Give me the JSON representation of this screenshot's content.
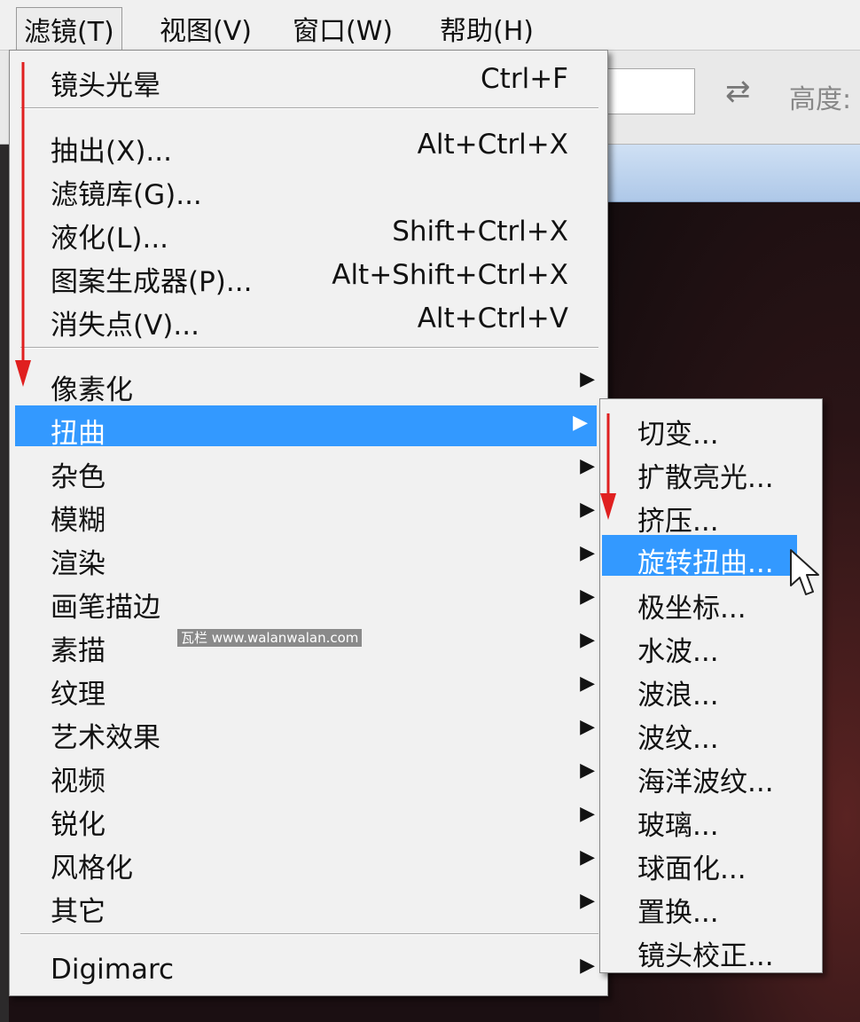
{
  "menubar": {
    "items": [
      {
        "label": "滤镜(T)"
      },
      {
        "label": "视图(V)"
      },
      {
        "label": "窗口(W)"
      },
      {
        "label": "帮助(H)"
      }
    ]
  },
  "options_bar": {
    "height_label": "高度:",
    "swap_icon": "⇄"
  },
  "filter_menu": {
    "top_item": {
      "label": "镜头光晕",
      "shortcut": "Ctrl+F"
    },
    "tools": [
      {
        "label": "抽出(X)...",
        "shortcut": "Alt+Ctrl+X"
      },
      {
        "label": "滤镜库(G)...",
        "shortcut": ""
      },
      {
        "label": "液化(L)...",
        "shortcut": "Shift+Ctrl+X"
      },
      {
        "label": "图案生成器(P)...",
        "shortcut": "Alt+Shift+Ctrl+X"
      },
      {
        "label": "消失点(V)...",
        "shortcut": "Alt+Ctrl+V"
      }
    ],
    "groups": [
      {
        "label": "像素化"
      },
      {
        "label": "扭曲"
      },
      {
        "label": "杂色"
      },
      {
        "label": "模糊"
      },
      {
        "label": "渲染"
      },
      {
        "label": "画笔描边"
      },
      {
        "label": "素描"
      },
      {
        "label": "纹理"
      },
      {
        "label": "艺术效果"
      },
      {
        "label": "视频"
      },
      {
        "label": "锐化"
      },
      {
        "label": "风格化"
      },
      {
        "label": "其它"
      }
    ],
    "plugin": {
      "label": "Digimarc"
    },
    "active_group": "扭曲",
    "submenu_arrow": "▶"
  },
  "distort_submenu": {
    "items": [
      {
        "label": "切变..."
      },
      {
        "label": "扩散亮光..."
      },
      {
        "label": "挤压..."
      },
      {
        "label": "旋转扭曲..."
      },
      {
        "label": "极坐标..."
      },
      {
        "label": "水波..."
      },
      {
        "label": "波浪..."
      },
      {
        "label": "波纹..."
      },
      {
        "label": "海洋波纹..."
      },
      {
        "label": "玻璃..."
      },
      {
        "label": "球面化..."
      },
      {
        "label": "置换..."
      },
      {
        "label": "镜头校正..."
      }
    ],
    "active_item": "旋转扭曲..."
  },
  "watermark": {
    "text": "瓦栏 www.walanwalan.com"
  },
  "colors": {
    "highlight": "#3399ff",
    "annotation_arrow": "#e02020"
  }
}
